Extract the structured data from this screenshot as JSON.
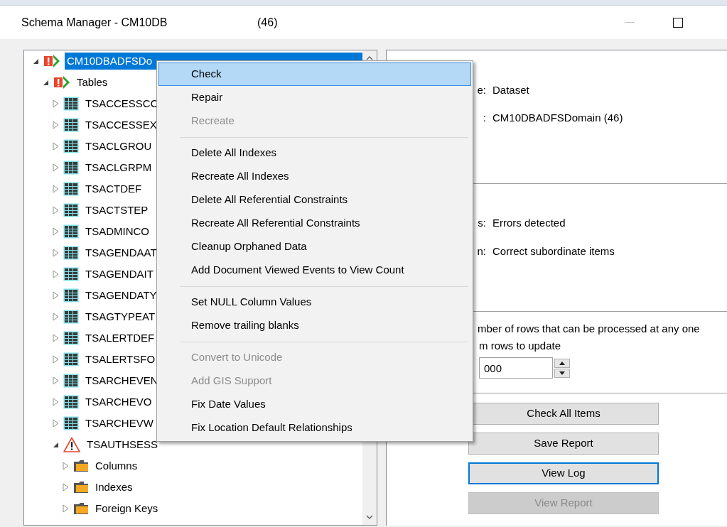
{
  "window": {
    "title": "Schema Manager - CM10DB",
    "count": "(46)"
  },
  "tree": [
    {
      "label": "CM10DBADFSDo",
      "kind": "error",
      "expanded": true,
      "selected": true,
      "children": [
        {
          "label": "Tables",
          "kind": "error",
          "expanded": true,
          "selected": false,
          "children": [
            {
              "label": "TSACCESSCO",
              "kind": "table",
              "expanded": false,
              "selected": false
            },
            {
              "label": "TSACCESSEX",
              "kind": "table",
              "expanded": false,
              "selected": false
            },
            {
              "label": "TSACLGROU",
              "kind": "table",
              "expanded": false,
              "selected": false
            },
            {
              "label": "TSACLGRPM",
              "kind": "table",
              "expanded": false,
              "selected": false
            },
            {
              "label": "TSACTDEF",
              "kind": "table",
              "expanded": false,
              "selected": false
            },
            {
              "label": "TSACTSTEP",
              "kind": "table",
              "expanded": false,
              "selected": false
            },
            {
              "label": "TSADMINCO",
              "kind": "table",
              "expanded": false,
              "selected": false
            },
            {
              "label": "TSAGENDAAT",
              "kind": "table",
              "expanded": false,
              "selected": false
            },
            {
              "label": "TSAGENDAIT",
              "kind": "table",
              "expanded": false,
              "selected": false
            },
            {
              "label": "TSAGENDATY",
              "kind": "table",
              "expanded": false,
              "selected": false
            },
            {
              "label": "TSAGTYPEAT",
              "kind": "table",
              "expanded": false,
              "selected": false
            },
            {
              "label": "TSALERTDEF",
              "kind": "table",
              "expanded": false,
              "selected": false
            },
            {
              "label": "TSALERTSFO",
              "kind": "table",
              "expanded": false,
              "selected": false
            },
            {
              "label": "TSARCHEVEN",
              "kind": "table",
              "expanded": false,
              "selected": false
            },
            {
              "label": "TSARCHEVO",
              "kind": "table",
              "expanded": false,
              "selected": false
            },
            {
              "label": "TSARCHEVW",
              "kind": "table",
              "expanded": false,
              "selected": false
            },
            {
              "label": "TSAUTHSESS",
              "kind": "warning",
              "expanded": true,
              "selected": false,
              "children": [
                {
                  "label": "Columns",
                  "kind": "folder",
                  "expanded": false,
                  "selected": false
                },
                {
                  "label": "Indexes",
                  "kind": "folder",
                  "expanded": false,
                  "selected": false
                },
                {
                  "label": "Foreign Keys",
                  "kind": "folder",
                  "expanded": false,
                  "selected": false
                }
              ]
            }
          ]
        }
      ]
    }
  ],
  "context_menu": [
    {
      "kind": "item",
      "label": "Check",
      "selected": true,
      "disabled": false
    },
    {
      "kind": "item",
      "label": "Repair",
      "selected": false,
      "disabled": false
    },
    {
      "kind": "item",
      "label": "Recreate",
      "selected": false,
      "disabled": true
    },
    {
      "kind": "separator"
    },
    {
      "kind": "item",
      "label": "Delete All Indexes",
      "selected": false,
      "disabled": false
    },
    {
      "kind": "item",
      "label": "Recreate All Indexes",
      "selected": false,
      "disabled": false
    },
    {
      "kind": "item",
      "label": "Delete All Referential Constraints",
      "selected": false,
      "disabled": false
    },
    {
      "kind": "item",
      "label": "Recreate All Referential Constraints",
      "selected": false,
      "disabled": false
    },
    {
      "kind": "item",
      "label": "Cleanup Orphaned Data",
      "selected": false,
      "disabled": false
    },
    {
      "kind": "item",
      "label": "Add Document Viewed Events to View Count",
      "selected": false,
      "disabled": false
    },
    {
      "kind": "separator"
    },
    {
      "kind": "item",
      "label": "Set NULL Column Values",
      "selected": false,
      "disabled": false
    },
    {
      "kind": "item",
      "label": "Remove trailing blanks",
      "selected": false,
      "disabled": false
    },
    {
      "kind": "separator"
    },
    {
      "kind": "item",
      "label": "Convert to Unicode",
      "selected": false,
      "disabled": true
    },
    {
      "kind": "item",
      "label": "Add GIS Support",
      "selected": false,
      "disabled": true
    },
    {
      "kind": "item",
      "label": "Fix Date Values",
      "selected": false,
      "disabled": false
    },
    {
      "kind": "item",
      "label": "Fix Location Default Relationships",
      "selected": false,
      "disabled": false
    }
  ],
  "details": {
    "object": [
      {
        "label": "e:",
        "value": "Dataset"
      },
      {
        "label": ":",
        "value": "CM10DBADFSDomain (46)"
      }
    ],
    "status": [
      {
        "label": "s:",
        "value": "Errors detected"
      },
      {
        "label": "n:",
        "value": "Correct subordinate items"
      }
    ],
    "batch": {
      "description": "mber of rows that can be processed at any one",
      "field_label": "m rows to update",
      "value": "000"
    },
    "buttons": [
      {
        "label": "Check All Items",
        "focused": false,
        "disabled": false
      },
      {
        "label": "Save Report",
        "focused": false,
        "disabled": false
      },
      {
        "label": "View Log",
        "focused": true,
        "disabled": false
      },
      {
        "label": "View Report",
        "focused": false,
        "disabled": true
      }
    ]
  }
}
